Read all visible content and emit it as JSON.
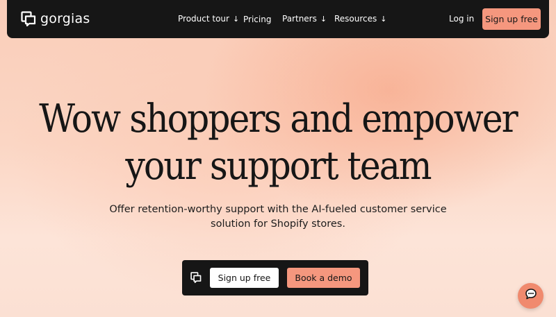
{
  "brand": {
    "name": "gorgias"
  },
  "nav": {
    "items": [
      {
        "label": "Product tour",
        "has_dropdown": true
      },
      {
        "label": "Pricing",
        "has_dropdown": false
      },
      {
        "label": "Partners",
        "has_dropdown": true
      },
      {
        "label": "Resources",
        "has_dropdown": true
      }
    ],
    "dropdown_icon": "arrow-down-icon",
    "login_label": "Log in",
    "signup_label": "Sign up free"
  },
  "hero": {
    "headline_line1": "Wow shoppers and empower",
    "headline_line2": "your support team",
    "subtitle_line1": "Offer retention-worthy support with the AI-fueled customer service",
    "subtitle_line2": "solution for Shopify stores."
  },
  "cta": {
    "icon": "gorgias-logo-icon",
    "signup_label": "Sign up free",
    "demo_label": "Book a demo"
  },
  "chat": {
    "icon": "chat-bubble-icon"
  },
  "colors": {
    "nav_bg": "#161616",
    "accent": "#f5977e",
    "chat_button": "#f08a6e",
    "hero_bg": "#fbd6c4"
  }
}
